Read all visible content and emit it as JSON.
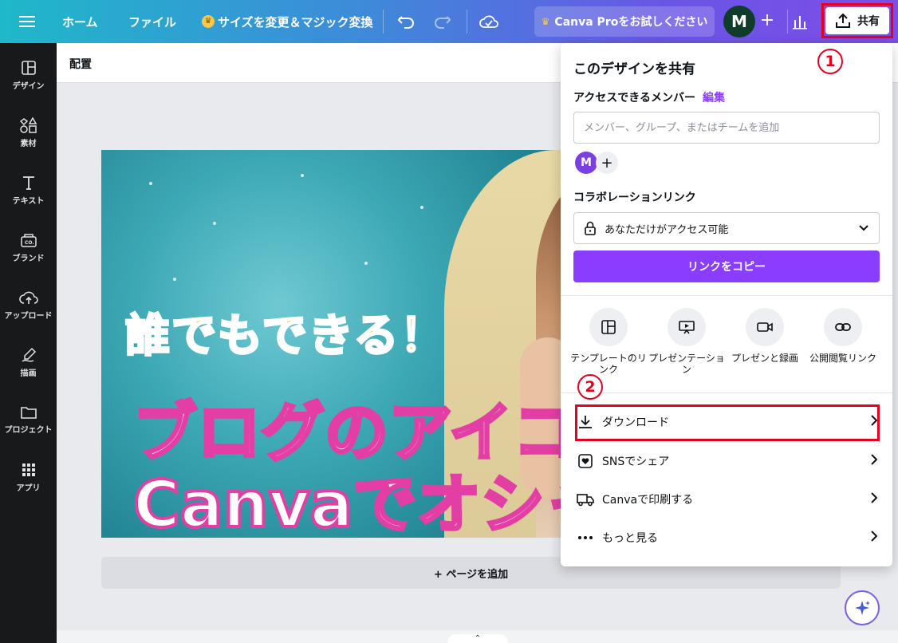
{
  "topbar": {
    "home": "ホーム",
    "file": "ファイル",
    "resize": "サイズを変更＆マジック変換",
    "pro_cta": "Canva Proをお試しください",
    "avatar": "M",
    "share": "共有"
  },
  "sidebar": {
    "items": [
      {
        "label": "デザイン",
        "icon": "layout-icon"
      },
      {
        "label": "素材",
        "icon": "shapes-icon"
      },
      {
        "label": "テキスト",
        "icon": "text-icon"
      },
      {
        "label": "ブランド",
        "icon": "brand-icon"
      },
      {
        "label": "アップロード",
        "icon": "upload-icon"
      },
      {
        "label": "描画",
        "icon": "draw-icon"
      },
      {
        "label": "プロジェクト",
        "icon": "folder-icon"
      },
      {
        "label": "アプリ",
        "icon": "apps-icon"
      }
    ]
  },
  "subbar": {
    "label": "配置"
  },
  "canvas": {
    "line1": "誰でもできる！",
    "line2": "ブログのアイコ",
    "line3": "Canvaでオシャ"
  },
  "add_page": "+ ページを追加",
  "panel": {
    "title": "このデザインを共有",
    "access_label": "アクセスできるメンバー",
    "edit": "編集",
    "member_placeholder": "メンバー、グループ、またはチームを追加",
    "avatar": "M",
    "collab_label": "コラボレーションリンク",
    "access_value": "あなただけがアクセス可能",
    "copy_link": "リンクをコピー",
    "options": [
      {
        "label": "テンプレートのリンク",
        "icon": "template-icon"
      },
      {
        "label": "プレゼンテーション",
        "icon": "present-icon"
      },
      {
        "label": "プレゼンと録画",
        "icon": "record-icon"
      },
      {
        "label": "公開閲覧リンク",
        "icon": "link-icon"
      }
    ],
    "menu": [
      {
        "label": "ダウンロード",
        "icon": "download-icon"
      },
      {
        "label": "SNSでシェア",
        "icon": "heart-icon"
      },
      {
        "label": "Canvaで印刷する",
        "icon": "truck-icon"
      },
      {
        "label": "もっと見る",
        "icon": "more-icon"
      }
    ]
  },
  "annotations": {
    "step1": "1",
    "step2": "2"
  },
  "colors": {
    "accent": "#8b3dff",
    "highlight": "#e6001f",
    "sidebar": "#18191b"
  }
}
